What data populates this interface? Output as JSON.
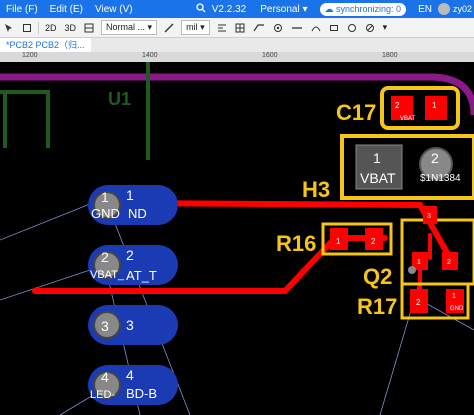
{
  "menu": {
    "file": "File (F)",
    "edit": "Edit (E)",
    "view": "View (V)",
    "version": "V2.2.32",
    "edition": "Personal",
    "sync": "synchronizing: 0",
    "language": "EN",
    "user": "zy02"
  },
  "toolbar": {
    "view_2d": "2D",
    "view_3d": "3D",
    "layer_mode": "Normal ...",
    "unit": "mil"
  },
  "tabs": [
    {
      "label": "*PCB2 PCB2（归..."
    }
  ],
  "ruler": {
    "ticks": [
      "1200",
      "1400",
      "1600",
      "1800"
    ]
  },
  "pcb": {
    "designators": {
      "c17": "C17",
      "h3": "H3",
      "r16": "R16",
      "q2": "Q2",
      "r17": "R17",
      "u1": "U1"
    },
    "h3_pads": [
      {
        "num": "1",
        "net": "VBAT"
      },
      {
        "num": "2",
        "net": "$1N1384"
      }
    ],
    "c17_pads": [
      {
        "num": "2",
        "net": "VBAT"
      },
      {
        "num": "1",
        "net": ""
      }
    ],
    "r16_pads": [
      {
        "num": "1"
      },
      {
        "num": "2"
      }
    ],
    "r17_pads": [
      {
        "num": "2"
      },
      {
        "num": "1",
        "net": "GND"
      }
    ],
    "q2_pads": [
      {
        "num": "3"
      },
      {
        "num": "1"
      },
      {
        "num": "2"
      }
    ],
    "connector_pins": [
      {
        "num": "1",
        "net": "GND",
        "net_tail": "ND"
      },
      {
        "num": "2",
        "net": "VBAT_",
        "net_tail": "AT_T"
      },
      {
        "num": "3",
        "net": "",
        "net_tail": ""
      },
      {
        "num": "4",
        "net": "LED-",
        "net_tail": "BD-B"
      }
    ]
  },
  "colors": {
    "accent": "#1a73e8",
    "board_outline": "#8b1a89",
    "silkscreen": "#f5c518",
    "copper": "#ff0000",
    "pad_blue": "#1a3bb4",
    "background": "#000000"
  }
}
